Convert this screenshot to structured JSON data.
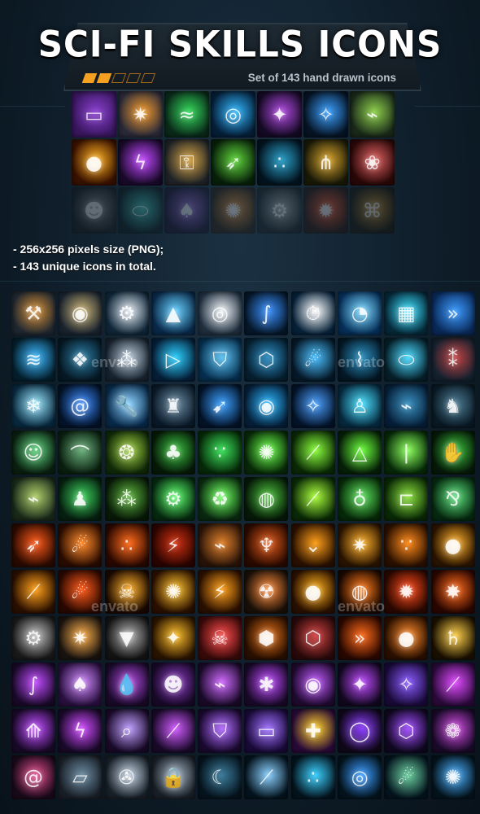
{
  "header": {
    "title": "SCI-FI SKILLS ICONS",
    "subtitle": "Set of 143 hand drawn icons",
    "progress_dots": [
      true,
      true,
      false,
      false,
      false
    ],
    "accent": "#f4a020"
  },
  "features": [
    "- 256x256 pixels size (PNG);",
    "- 143 unique icons in total."
  ],
  "watermark": "envato",
  "preview_icons": [
    {
      "name": "card-tech-icon",
      "colors": [
        "#3a1760",
        "#8a3fd0"
      ],
      "glyph": "▭"
    },
    {
      "name": "spark-burst-icon",
      "colors": [
        "#2a2a3a",
        "#f39a2a"
      ],
      "glyph": "✷"
    },
    {
      "name": "dna-helix-icon",
      "colors": [
        "#0a2a1a",
        "#33d95a"
      ],
      "glyph": "≈"
    },
    {
      "name": "vortex-blast-icon",
      "colors": [
        "#06203a",
        "#2fb7ff"
      ],
      "glyph": "◎"
    },
    {
      "name": "purple-runner-icon",
      "colors": [
        "#150a25",
        "#b04ae0"
      ],
      "glyph": "✦"
    },
    {
      "name": "constellation-icon",
      "colors": [
        "#061425",
        "#3aa0ff"
      ],
      "glyph": "✧"
    },
    {
      "name": "green-injector-icon",
      "colors": [
        "#1a2a1a",
        "#8ed04a"
      ],
      "glyph": "⌁"
    },
    {
      "name": "sun-core-icon",
      "colors": [
        "#3a1200",
        "#ffb020"
      ],
      "glyph": "●"
    },
    {
      "name": "purple-lightning-icon",
      "colors": [
        "#1a0a2a",
        "#c046ff"
      ],
      "glyph": "ϟ"
    },
    {
      "name": "caution-key-icon",
      "colors": [
        "#202428",
        "#d2a040"
      ],
      "glyph": "⚿"
    },
    {
      "name": "green-streak-icon",
      "colors": [
        "#08200a",
        "#5ed43a"
      ],
      "glyph": "➶"
    },
    {
      "name": "blue-particles-icon",
      "colors": [
        "#031420",
        "#2a9fc8"
      ],
      "glyph": "∴"
    },
    {
      "name": "golden-roots-icon",
      "colors": [
        "#1a1a08",
        "#d6a22a"
      ],
      "glyph": "⋔"
    },
    {
      "name": "brain-icon",
      "colors": [
        "#2a0808",
        "#e06060"
      ],
      "glyph": "❀"
    },
    {
      "name": "gas-mask-icon",
      "colors": [
        "#1a1a1a",
        "#8a8a8a"
      ],
      "glyph": "☻"
    },
    {
      "name": "capsule-icon",
      "colors": [
        "#0a1a1a",
        "#3ad0c0"
      ],
      "glyph": "⬭"
    },
    {
      "name": "card-spade-icon",
      "colors": [
        "#1a0a2a",
        "#9a60d0"
      ],
      "glyph": "♠"
    },
    {
      "name": "orange-flare-icon",
      "colors": [
        "#2a1400",
        "#f08a2a"
      ],
      "glyph": "✺"
    },
    {
      "name": "saw-blade-icon",
      "colors": [
        "#1a1a1a",
        "#b0b0b0"
      ],
      "glyph": "⚙"
    },
    {
      "name": "red-energy-icon",
      "colors": [
        "#2a0a00",
        "#ff5020"
      ],
      "glyph": "✹"
    },
    {
      "name": "amber-web-icon",
      "colors": [
        "#1a1000",
        "#d08a20"
      ],
      "glyph": "⌘"
    }
  ],
  "main_icons": [
    {
      "name": "robotic-claw-icon",
      "colors": [
        "#202832",
        "#d08a30"
      ],
      "glyph": "⚒"
    },
    {
      "name": "asteroid-gear-icon",
      "colors": [
        "#1a2430",
        "#c8b070"
      ],
      "glyph": "◉"
    },
    {
      "name": "cog-icon",
      "colors": [
        "#10283a",
        "#e0e8f0"
      ],
      "glyph": "⚙"
    },
    {
      "name": "blue-arrow-emblem-icon",
      "colors": [
        "#0a2a4a",
        "#66d0ff"
      ],
      "glyph": "▲"
    },
    {
      "name": "target-swirl-icon",
      "colors": [
        "#203040",
        "#f0f4f8"
      ],
      "glyph": "◎"
    },
    {
      "name": "blue-serpent-icon",
      "colors": [
        "#06182a",
        "#3a90ff"
      ],
      "glyph": "∫"
    },
    {
      "name": "stopwatch-icon",
      "colors": [
        "#06223a",
        "#ffffff"
      ],
      "glyph": "⏱"
    },
    {
      "name": "speedometer-icon",
      "colors": [
        "#06305a",
        "#7ad8ff"
      ],
      "glyph": "◔"
    },
    {
      "name": "portal-grid-icon",
      "colors": [
        "#062a3a",
        "#3ae0ff"
      ],
      "glyph": "▦"
    },
    {
      "name": "blue-chevrons-icon",
      "colors": [
        "#0a2a5a",
        "#3a9aff"
      ],
      "glyph": "»"
    },
    {
      "name": "water-splash-icon",
      "colors": [
        "#04202e",
        "#3ab8ff"
      ],
      "glyph": "≋"
    },
    {
      "name": "dark-fish-icon",
      "colors": [
        "#061a26",
        "#2a7aa0"
      ],
      "glyph": "❖"
    },
    {
      "name": "gatling-gun-icon",
      "colors": [
        "#182430",
        "#b8c8d8"
      ],
      "glyph": "⁂"
    },
    {
      "name": "blue-triangle-play-icon",
      "colors": [
        "#06203a",
        "#2ad0ff"
      ],
      "glyph": "▷"
    },
    {
      "name": "shield-icon",
      "colors": [
        "#063050",
        "#5ac0f0"
      ],
      "glyph": "⛉"
    },
    {
      "name": "hex-grid-icon",
      "colors": [
        "#062030",
        "#2a8ac0"
      ],
      "glyph": "⬡"
    },
    {
      "name": "blue-comet-icon",
      "colors": [
        "#061a2a",
        "#4ac0ff"
      ],
      "glyph": "☄"
    },
    {
      "name": "tree-silhouette-icon",
      "colors": [
        "#041826",
        "#2a90c0"
      ],
      "glyph": "⌇"
    },
    {
      "name": "cyan-tube-icon",
      "colors": [
        "#06202a",
        "#4adaff"
      ],
      "glyph": "⬭"
    },
    {
      "name": "twin-turret-icon",
      "colors": [
        "#142230",
        "#c04040"
      ],
      "glyph": "⁑"
    },
    {
      "name": "ice-crystal-icon",
      "colors": [
        "#082a40",
        "#9ae8ff"
      ],
      "glyph": "❄"
    },
    {
      "name": "blue-galaxy-icon",
      "colors": [
        "#04142a",
        "#3a8aff"
      ],
      "glyph": "@"
    },
    {
      "name": "wrench-sparkle-icon",
      "colors": [
        "#082a4a",
        "#8ad0ff"
      ],
      "glyph": "🔧"
    },
    {
      "name": "robot-sentinel-icon",
      "colors": [
        "#0a1a2a",
        "#6a8aa0"
      ],
      "glyph": "♜"
    },
    {
      "name": "blue-streaks-icon",
      "colors": [
        "#04142a",
        "#3aa0ff"
      ],
      "glyph": "➹"
    },
    {
      "name": "blue-vortex-blast-icon",
      "colors": [
        "#06203a",
        "#2ab7ff"
      ],
      "glyph": "◉"
    },
    {
      "name": "blue-constellation-icon",
      "colors": [
        "#04142a",
        "#4aa0ff"
      ],
      "glyph": "✧"
    },
    {
      "name": "teleport-figure-icon",
      "colors": [
        "#062a40",
        "#4ae0ff"
      ],
      "glyph": "♙"
    },
    {
      "name": "blue-cannon-icon",
      "colors": [
        "#06203a",
        "#3a90c0"
      ],
      "glyph": "⌁"
    },
    {
      "name": "shadow-beast-icon",
      "colors": [
        "#0a1a26",
        "#4a7a90"
      ],
      "glyph": "♞"
    },
    {
      "name": "green-alien-icon",
      "colors": [
        "#0a2010",
        "#5ad07a"
      ],
      "glyph": "☺"
    },
    {
      "name": "green-bridge-icon",
      "colors": [
        "#0a2010",
        "#6ab07a"
      ],
      "glyph": "⌒"
    },
    {
      "name": "spotted-spore-icon",
      "colors": [
        "#102a08",
        "#a0d040"
      ],
      "glyph": "❂"
    },
    {
      "name": "green-creature-icon",
      "colors": [
        "#061a08",
        "#3ac040"
      ],
      "glyph": "♣"
    },
    {
      "name": "green-spores-icon",
      "colors": [
        "#062a08",
        "#3ae05a"
      ],
      "glyph": "∵"
    },
    {
      "name": "green-virus-icon",
      "colors": [
        "#082a08",
        "#6aff4a"
      ],
      "glyph": "✺"
    },
    {
      "name": "green-rays-icon",
      "colors": [
        "#0a2a06",
        "#8aff3a"
      ],
      "glyph": "⟋"
    },
    {
      "name": "green-triangle-icon",
      "colors": [
        "#062008",
        "#6aff3a"
      ],
      "glyph": "△"
    },
    {
      "name": "green-beam-icon",
      "colors": [
        "#062a08",
        "#8aff5a"
      ],
      "glyph": "|"
    },
    {
      "name": "green-hand-icon",
      "colors": [
        "#061a08",
        "#3ac03a"
      ],
      "glyph": "✋"
    },
    {
      "name": "green-syringe-icon",
      "colors": [
        "#1a2a1a",
        "#b0d06a"
      ],
      "glyph": "⌁"
    },
    {
      "name": "green-ghost-figure-icon",
      "colors": [
        "#062010",
        "#3ad05a"
      ],
      "glyph": "♟"
    },
    {
      "name": "green-hair-burst-icon",
      "colors": [
        "#081a08",
        "#5ab03a"
      ],
      "glyph": "⁂"
    },
    {
      "name": "green-cog-ring-icon",
      "colors": [
        "#062a10",
        "#5aff6a"
      ],
      "glyph": "⚙"
    },
    {
      "name": "green-recycle-icon",
      "colors": [
        "#0a2a10",
        "#6aff5a"
      ],
      "glyph": "♻"
    },
    {
      "name": "green-planet-icon",
      "colors": [
        "#061a08",
        "#4ac03a"
      ],
      "glyph": "◍"
    },
    {
      "name": "green-laser-icon",
      "colors": [
        "#0a2a06",
        "#aaff3a"
      ],
      "glyph": "⟋"
    },
    {
      "name": "green-jar-creature-icon",
      "colors": [
        "#062a08",
        "#5ae05a"
      ],
      "glyph": "♁"
    },
    {
      "name": "green-pipe-icon",
      "colors": [
        "#0a2a06",
        "#8ae03a"
      ],
      "glyph": "⊏"
    },
    {
      "name": "green-tentacles-icon",
      "colors": [
        "#062a10",
        "#5ae07a"
      ],
      "glyph": "⅋"
    },
    {
      "name": "fire-streak-icon",
      "colors": [
        "#2a0a00",
        "#ff5a1a"
      ],
      "glyph": "➶"
    },
    {
      "name": "fireball-comet-icon",
      "colors": [
        "#2a0c00",
        "#ff8a2a"
      ],
      "glyph": "☄"
    },
    {
      "name": "fire-particles-icon",
      "colors": [
        "#2a0800",
        "#ff6a1a"
      ],
      "glyph": "∴"
    },
    {
      "name": "lava-crack-icon",
      "colors": [
        "#2a0400",
        "#d03010"
      ],
      "glyph": "⚡"
    },
    {
      "name": "flame-cannon-icon",
      "colors": [
        "#2a1408",
        "#e0802a"
      ],
      "glyph": "⌁"
    },
    {
      "name": "flame-squid-icon",
      "colors": [
        "#2a0a00",
        "#e05a1a"
      ],
      "glyph": "♆"
    },
    {
      "name": "orange-chevrons-icon",
      "colors": [
        "#2a1000",
        "#ffa01a"
      ],
      "glyph": "⌄"
    },
    {
      "name": "orange-spark-gun-icon",
      "colors": [
        "#2a1400",
        "#ffb02a"
      ],
      "glyph": "✷"
    },
    {
      "name": "orange-particles-icon",
      "colors": [
        "#2a1000",
        "#ff8a1a"
      ],
      "glyph": "∵"
    },
    {
      "name": "eclipse-icon",
      "colors": [
        "#2a1400",
        "#ffb02a"
      ],
      "glyph": "●"
    },
    {
      "name": "orange-slash-icon",
      "colors": [
        "#2a1000",
        "#ffa01a"
      ],
      "glyph": "⟋"
    },
    {
      "name": "meteor-shower-icon",
      "colors": [
        "#2a0800",
        "#ff5a1a"
      ],
      "glyph": "☄"
    },
    {
      "name": "burning-skeleton-icon",
      "colors": [
        "#1a0800",
        "#ffb02a"
      ],
      "glyph": "☠"
    },
    {
      "name": "orange-laser-blast-icon",
      "colors": [
        "#2a1000",
        "#ffc02a"
      ],
      "glyph": "✺"
    },
    {
      "name": "lightning-bolt-icon",
      "colors": [
        "#2a1000",
        "#ffa01a"
      ],
      "glyph": "⚡"
    },
    {
      "name": "mushroom-cloud-icon",
      "colors": [
        "#1a1008",
        "#ff8a3a"
      ],
      "glyph": "☢"
    },
    {
      "name": "molten-sun-icon",
      "colors": [
        "#2a1000",
        "#ffb01a"
      ],
      "glyph": "●"
    },
    {
      "name": "orange-planet-icon",
      "colors": [
        "#1a0800",
        "#ff7a1a"
      ],
      "glyph": "◍"
    },
    {
      "name": "flame-rays-icon",
      "colors": [
        "#2a0800",
        "#ff4a1a"
      ],
      "glyph": "✹"
    },
    {
      "name": "fire-explosion-icon",
      "colors": [
        "#2a0600",
        "#ff6a1a"
      ],
      "glyph": "✸"
    },
    {
      "name": "buzzsaw-icon",
      "colors": [
        "#1a1a1a",
        "#c0c0c0"
      ],
      "glyph": "⚙"
    },
    {
      "name": "forge-sparks-icon",
      "colors": [
        "#1a1410",
        "#ffb04a"
      ],
      "glyph": "✷"
    },
    {
      "name": "drill-icon",
      "colors": [
        "#141414",
        "#b0b0b0"
      ],
      "glyph": "▼"
    },
    {
      "name": "golden-creature-icon",
      "colors": [
        "#2a1400",
        "#ffc02a"
      ],
      "glyph": "✦"
    },
    {
      "name": "skull-badge-icon",
      "colors": [
        "#3a0a0a",
        "#ff4a4a"
      ],
      "glyph": "☠"
    },
    {
      "name": "orange-hexagons-icon",
      "colors": [
        "#2a1000",
        "#e0701a"
      ],
      "glyph": "⬢"
    },
    {
      "name": "hexagon-frame-icon",
      "colors": [
        "#2a0a0a",
        "#d04040"
      ],
      "glyph": "⬡"
    },
    {
      "name": "fire-dash-icon",
      "colors": [
        "#2a0800",
        "#ff6a1a"
      ],
      "glyph": "»"
    },
    {
      "name": "grenade-icon",
      "colors": [
        "#2a1000",
        "#ff8a2a"
      ],
      "glyph": "●"
    },
    {
      "name": "ringed-planet-icon",
      "colors": [
        "#1a1000",
        "#ffd04a"
      ],
      "glyph": "♄"
    },
    {
      "name": "purple-wisp-icon",
      "colors": [
        "#1a0a2a",
        "#c04aff"
      ],
      "glyph": "∫"
    },
    {
      "name": "purple-card-icon",
      "colors": [
        "#2a1040",
        "#d08aff"
      ],
      "glyph": "♠"
    },
    {
      "name": "purple-drop-icon",
      "colors": [
        "#1a0a2a",
        "#b04ae0"
      ],
      "glyph": "💧"
    },
    {
      "name": "purple-mask-icon",
      "colors": [
        "#1a0a2a",
        "#8a3ac0"
      ],
      "glyph": "☻"
    },
    {
      "name": "purple-injector-icon",
      "colors": [
        "#1a0a2a",
        "#d06aff"
      ],
      "glyph": "⌁"
    },
    {
      "name": "purple-spider-icon",
      "colors": [
        "#1a0a2a",
        "#c04aff"
      ],
      "glyph": "✱"
    },
    {
      "name": "purple-asteroid-icon",
      "colors": [
        "#200a30",
        "#c05aff"
      ],
      "glyph": "◉"
    },
    {
      "name": "purple-runner-small-icon",
      "colors": [
        "#120820",
        "#c04aff"
      ],
      "glyph": "✦"
    },
    {
      "name": "purple-claw-icon",
      "colors": [
        "#1a0a3a",
        "#8a5aff"
      ],
      "glyph": "✧"
    },
    {
      "name": "purple-blade-icon",
      "colors": [
        "#2a0a3a",
        "#e04aff"
      ],
      "glyph": "⟋"
    },
    {
      "name": "purple-feathers-icon",
      "colors": [
        "#1a0a2a",
        "#c04aff"
      ],
      "glyph": "⟰"
    },
    {
      "name": "purple-lightning-small-icon",
      "colors": [
        "#1a0a2a",
        "#d04aff"
      ],
      "glyph": "ϟ"
    },
    {
      "name": "magnifier-icon",
      "colors": [
        "#1a0a2a",
        "#c0a0ff"
      ],
      "glyph": "⌕"
    },
    {
      "name": "purple-slash-icon",
      "colors": [
        "#1a0a2a",
        "#d05aff"
      ],
      "glyph": "⟋"
    },
    {
      "name": "purple-rune-shield-icon",
      "colors": [
        "#1a0a30",
        "#b06aff"
      ],
      "glyph": "⛉"
    },
    {
      "name": "purple-tablet-icon",
      "colors": [
        "#1a0a3a",
        "#a070ff"
      ],
      "glyph": "▭"
    },
    {
      "name": "yellow-cross-icon",
      "colors": [
        "#2a0a3a",
        "#ffd020"
      ],
      "glyph": "✚"
    },
    {
      "name": "purple-orb-icon",
      "colors": [
        "#10081a",
        "#8a3aff"
      ],
      "glyph": "◯"
    },
    {
      "name": "purple-hexagon-icon",
      "colors": [
        "#100820",
        "#a04aff"
      ],
      "glyph": "⬡"
    },
    {
      "name": "purple-bloom-icon",
      "colors": [
        "#1a0a2a",
        "#d04ae0"
      ],
      "glyph": "❁"
    },
    {
      "name": "spiral-galaxy-icon",
      "colors": [
        "#1a0a1a",
        "#e04a8a"
      ],
      "glyph": "@"
    },
    {
      "name": "metal-plate-icon",
      "colors": [
        "#1a2028",
        "#6a8aa0"
      ],
      "glyph": "▱"
    },
    {
      "name": "fan-disc-icon",
      "colors": [
        "#182028",
        "#c0d0e0"
      ],
      "glyph": "✇"
    },
    {
      "name": "padlock-icon",
      "colors": [
        "#1a2028",
        "#a0b0c0"
      ],
      "glyph": "🔒"
    },
    {
      "name": "dark-crescent-icon",
      "colors": [
        "#06141e",
        "#3a7a9a"
      ],
      "glyph": "☾"
    },
    {
      "name": "light-beams-icon",
      "colors": [
        "#04141e",
        "#8ad0ff"
      ],
      "glyph": "⟋"
    },
    {
      "name": "cyan-particles-icon",
      "colors": [
        "#04141e",
        "#3ad0ff"
      ],
      "glyph": "∴"
    },
    {
      "name": "blue-rings-icon",
      "colors": [
        "#04141e",
        "#3a9aff"
      ],
      "glyph": "◎"
    },
    {
      "name": "green-comet-icon",
      "colors": [
        "#04141e",
        "#6ad0a0"
      ],
      "glyph": "☄"
    },
    {
      "name": "blue-crackle-icon",
      "colors": [
        "#04141e",
        "#4ab0ff"
      ],
      "glyph": "✺"
    }
  ]
}
